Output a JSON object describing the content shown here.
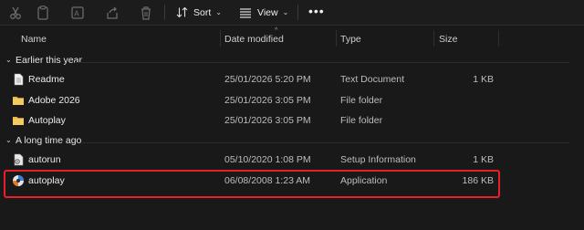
{
  "toolbar": {
    "sort_label": "Sort",
    "view_label": "View",
    "more_label": "•••"
  },
  "columns": {
    "name": "Name",
    "date": "Date modified",
    "type": "Type",
    "size": "Size"
  },
  "groups": [
    {
      "title": "Earlier this year",
      "rows": [
        {
          "name": "Readme",
          "date": "25/01/2026 5:20 PM",
          "type": "Text Document",
          "size": "1 KB",
          "icon": "text-file-icon"
        },
        {
          "name": "Adobe 2026",
          "date": "25/01/2026 3:05 PM",
          "type": "File folder",
          "size": "",
          "icon": "folder-icon"
        },
        {
          "name": "Autoplay",
          "date": "25/01/2026 3:05 PM",
          "type": "File folder",
          "size": "",
          "icon": "folder-icon"
        }
      ]
    },
    {
      "title": "A long time ago",
      "rows": [
        {
          "name": "autorun",
          "date": "05/10/2020 1:08 PM",
          "type": "Setup Information",
          "size": "1 KB",
          "icon": "setup-info-icon"
        },
        {
          "name": "autoplay",
          "date": "06/08/2008 1:23 AM",
          "type": "Application",
          "size": "186 KB",
          "icon": "application-icon"
        }
      ]
    }
  ],
  "colors": {
    "background": "#191919",
    "highlight": "#e8202a",
    "folder": "#e8b84a"
  }
}
